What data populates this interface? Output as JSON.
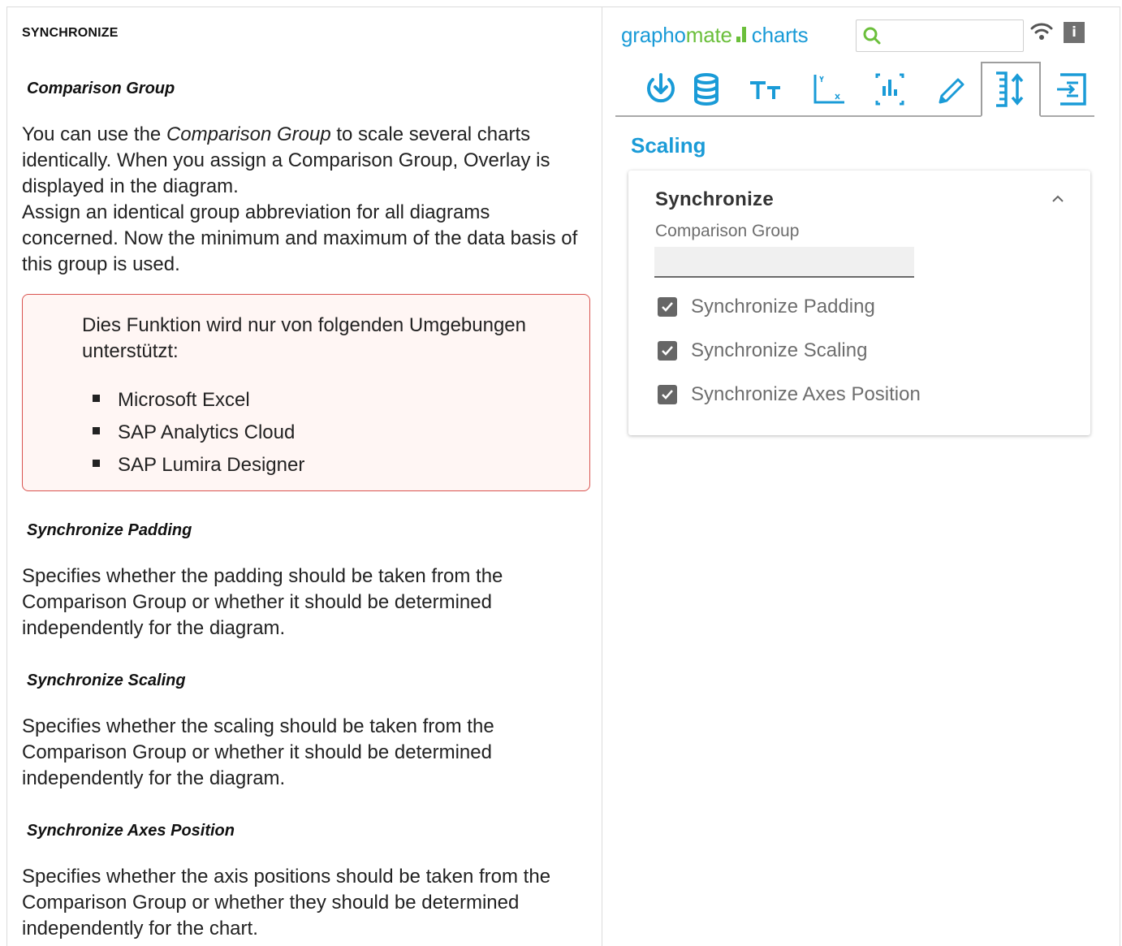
{
  "doc": {
    "heading": "SYNCHRONIZE",
    "sections": [
      {
        "title": "Comparison Group",
        "para_1_before": "You can use the ",
        "para_1_em": "Comparison Group",
        "para_1_after": " to scale several charts identically. When you assign a Comparison Group, Overlay is displayed in the diagram.",
        "para_2": "Assign an identical group abbreviation for all diagrams concerned. Now the minimum and maximum of the data basis of this group is used."
      },
      {
        "title": "Synchronize Padding",
        "text": "Specifies whether the padding should be taken from the Comparison Group or whether it should be determined independently for the diagram."
      },
      {
        "title": "Synchronize Scaling",
        "text": "Specifies whether the scaling should be taken from the Comparison Group or whether it should be determined independently for the diagram."
      },
      {
        "title": "Synchronize Axes Position",
        "text": "Specifies whether the axis positions should be taken from the Comparison Group or whether they should be determined independently for the chart."
      }
    ],
    "note": {
      "text": "Dies Funktion wird nur von folgenden Umgebungen unterstützt:",
      "items": [
        "Microsoft Excel",
        "SAP Analytics Cloud",
        "SAP Lumira Designer"
      ]
    }
  },
  "panel": {
    "brand_part1": "grapho",
    "brand_part2": "mate",
    "brand_part3": "charts",
    "search_placeholder": "",
    "info_label": "i",
    "toolbar_icons": [
      "download-icon",
      "database-icon",
      "text-size-icon",
      "axes-icon",
      "chart-area-icon",
      "pencil-icon",
      "scaling-icon",
      "layout-icon"
    ],
    "active_tool": "scaling-icon",
    "section_title": "Scaling",
    "card": {
      "title": "Synchronize",
      "field_label": "Comparison Group",
      "field_value": "",
      "checkboxes": [
        {
          "label": "Synchronize Padding",
          "checked": true
        },
        {
          "label": "Synchronize Scaling",
          "checked": true
        },
        {
          "label": "Synchronize Axes Position",
          "checked": true
        }
      ]
    }
  },
  "colors": {
    "brand_blue": "#1a9bd7",
    "brand_green": "#6bbf3b",
    "note_border": "#d9534f",
    "note_bg": "#fff6f4"
  }
}
